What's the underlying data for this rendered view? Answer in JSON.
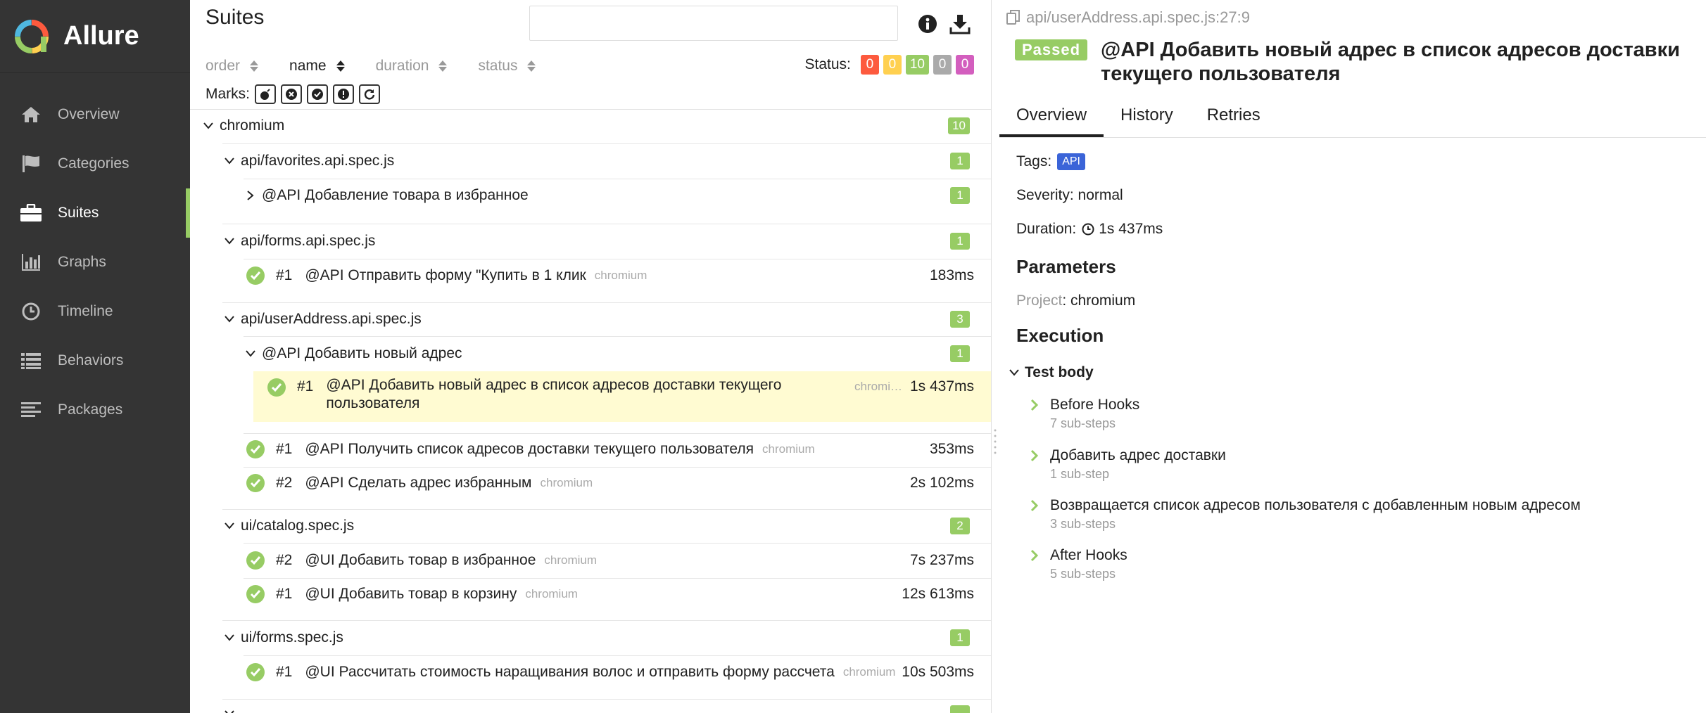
{
  "brand": {
    "name": "Allure"
  },
  "sidebar": {
    "items": [
      {
        "label": "Overview",
        "icon": "home-icon"
      },
      {
        "label": "Categories",
        "icon": "flag-icon"
      },
      {
        "label": "Suites",
        "icon": "briefcase-icon",
        "active": true
      },
      {
        "label": "Graphs",
        "icon": "bar-chart-icon"
      },
      {
        "label": "Timeline",
        "icon": "clock-icon"
      },
      {
        "label": "Behaviors",
        "icon": "list-icon"
      },
      {
        "label": "Packages",
        "icon": "align-left-icon"
      }
    ]
  },
  "tree": {
    "title": "Suites",
    "search": {
      "value": "",
      "placeholder": ""
    },
    "sort": {
      "order": "order",
      "name": "name",
      "duration": "duration",
      "status": "status"
    },
    "status_label": "Status:",
    "status_counts": [
      {
        "value": "0",
        "color": "#fd5a3e"
      },
      {
        "value": "0",
        "color": "#ffd050"
      },
      {
        "value": "10",
        "color": "#97cc64"
      },
      {
        "value": "0",
        "color": "#aaaaaa"
      },
      {
        "value": "0",
        "color": "#d35ebe"
      }
    ],
    "marks_label": "Marks:",
    "rows": {
      "chromium": {
        "label": "chromium",
        "count": "10"
      },
      "favorites": {
        "label": "api/favorites.api.spec.js",
        "count": "1"
      },
      "fav_group": {
        "label": "@API Добавление товара в избранное",
        "count": "1"
      },
      "forms": {
        "label": "api/forms.api.spec.js",
        "count": "1"
      },
      "forms_t1": {
        "num": "#1",
        "label": "@API Отправить форму \"Купить в 1 клик",
        "tag": "chromium",
        "dur": "183ms"
      },
      "addr": {
        "label": "api/userAddress.api.spec.js",
        "count": "3"
      },
      "addr_group": {
        "label": "@API Добавить новый адрес",
        "count": "1"
      },
      "addr_t1": {
        "num": "#1",
        "label_line1": "@API Добавить новый адрес в список адресов доставки текущего",
        "label_line2": "пользователя",
        "tag": "chromi…",
        "dur": "1s 437ms"
      },
      "addr_t2": {
        "num": "#1",
        "label": "@API Получить список адресов доставки текущего пользователя",
        "tag": "chromium",
        "dur": "353ms"
      },
      "addr_t3": {
        "num": "#2",
        "label": "@API Сделать адрес избранным",
        "tag": "chromium",
        "dur": "2s 102ms"
      },
      "catalog": {
        "label": "ui/catalog.spec.js",
        "count": "2"
      },
      "cat_t1": {
        "num": "#2",
        "label": "@UI Добавить товар в избранное",
        "tag": "chromium",
        "dur": "7s 237ms"
      },
      "cat_t2": {
        "num": "#1",
        "label": "@UI Добавить товар в корзину",
        "tag": "chromium",
        "dur": "12s 613ms"
      },
      "uiforms": {
        "label": "ui/forms.spec.js",
        "count": "1"
      },
      "uiforms_t1": {
        "num": "#1",
        "label": "@UI Рассчитать стоимость наращивания волос и отправить форму рассчета",
        "tag": "chromium",
        "dur": "10s 503ms"
      }
    }
  },
  "detail": {
    "crumb": "api/userAddress.api.spec.js:27:9",
    "status": "Passed",
    "title": "@API Добавить новый адрес в список адресов доставки текущего пользователя",
    "tabs": [
      "Overview",
      "History",
      "Retries"
    ],
    "tags_label": "Tags:",
    "tag": "API",
    "severity": "Severity: normal",
    "duration_label": "Duration:",
    "duration": "1s 437ms",
    "parameters_heading": "Parameters",
    "param_key": "Project",
    "param_value": ": chromium",
    "execution_heading": "Execution",
    "test_body": "Test body",
    "steps": [
      {
        "title": "Before Hooks",
        "sub": "7 sub-steps"
      },
      {
        "title": "Добавить адрес доставки",
        "sub": "1 sub-step"
      },
      {
        "title": "Возвращается список адресов пользователя с добавленным новым адресом",
        "sub": "3 sub-steps"
      },
      {
        "title": "After Hooks",
        "sub": "5 sub-steps"
      }
    ]
  }
}
